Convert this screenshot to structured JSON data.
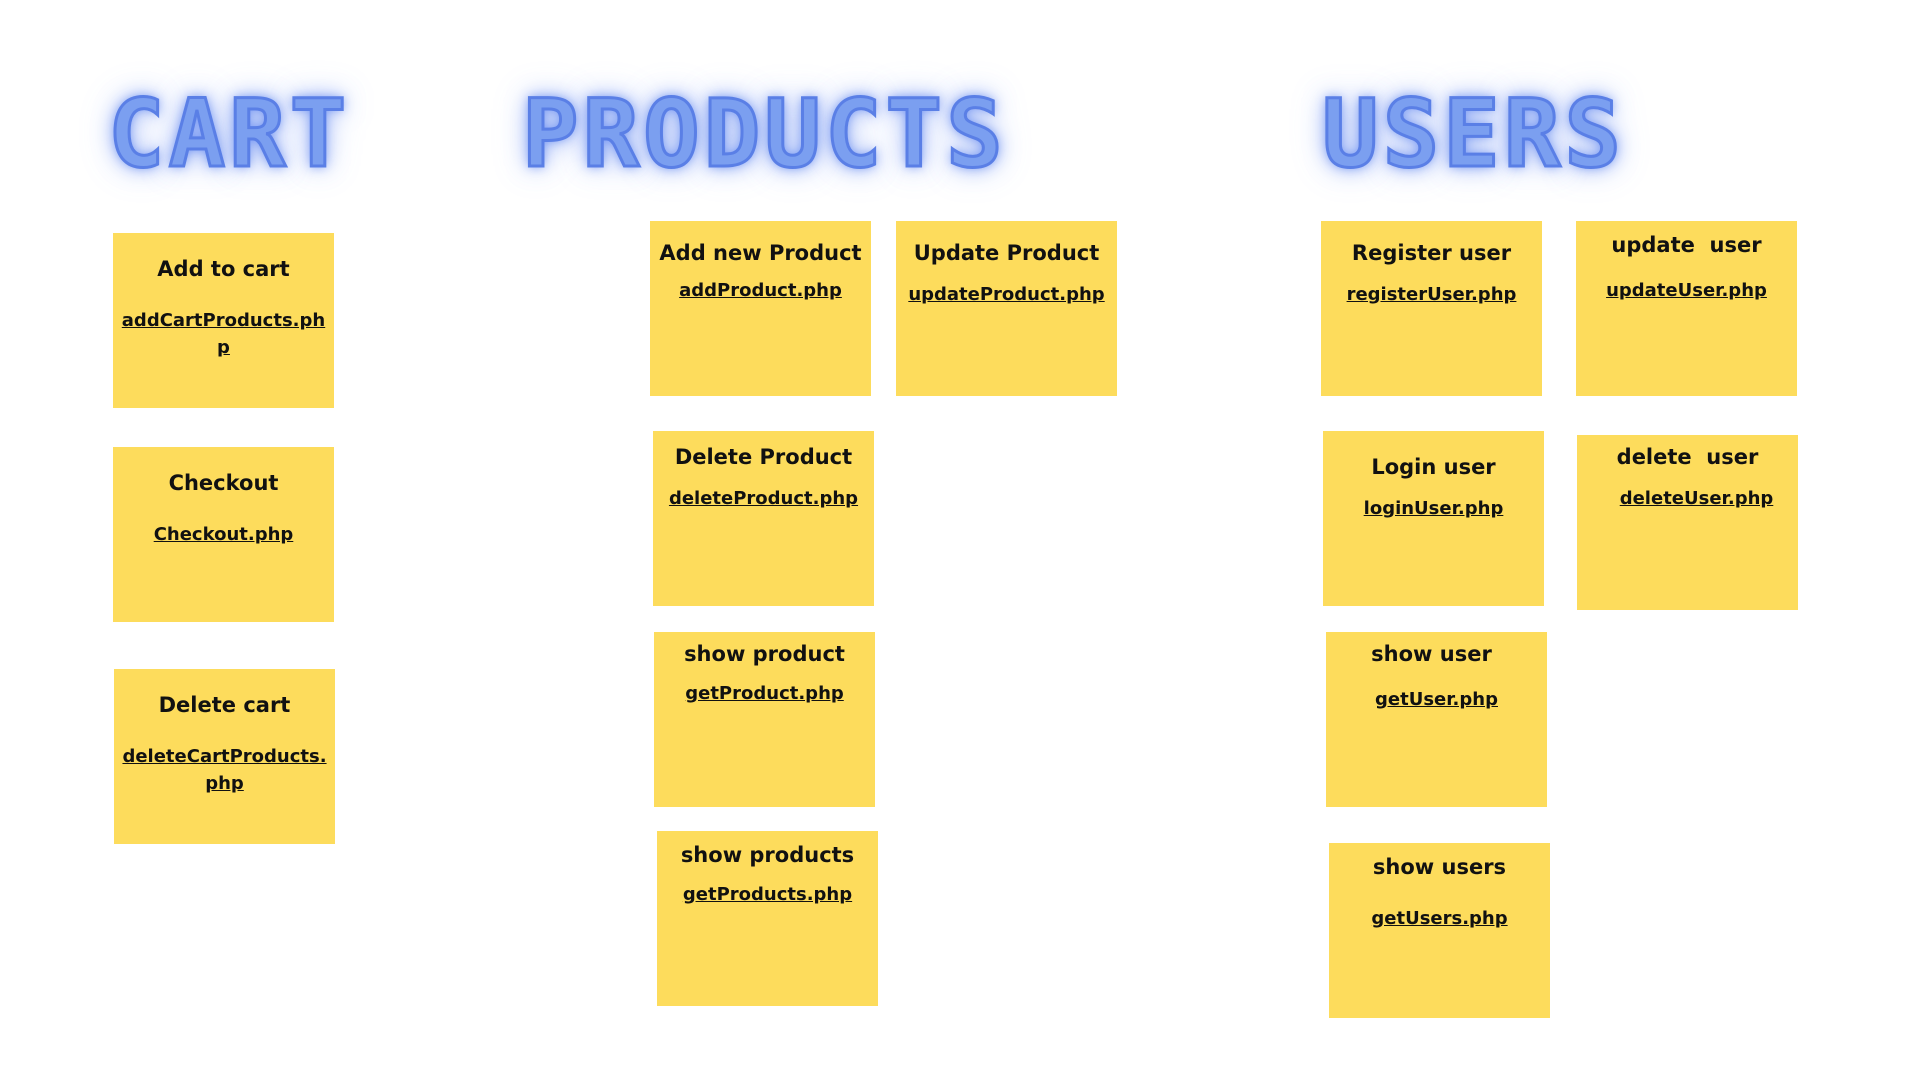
{
  "sections": {
    "cart": {
      "heading": "CART",
      "notes": [
        {
          "title": "Add to cart",
          "file": "addCartProducts.php"
        },
        {
          "title": "Checkout",
          "file": "Checkout.php"
        },
        {
          "title": "Delete cart",
          "file": "deleteCartProducts.php"
        }
      ]
    },
    "products": {
      "heading": "PRODUCTS",
      "notes": [
        {
          "title": "Add new Product",
          "file": "addProduct.php"
        },
        {
          "title": "Update Product",
          "file": "updateProduct.php"
        },
        {
          "title": "Delete Product",
          "file": "deleteProduct.php"
        },
        {
          "title": "show product",
          "file": "getProduct.php"
        },
        {
          "title": "show products",
          "file": "getProducts.php"
        }
      ]
    },
    "users": {
      "heading": "USERS",
      "notes": [
        {
          "title": "Register user",
          "file": "registerUser.php"
        },
        {
          "title": "update  user",
          "file": "updateUser.php"
        },
        {
          "title": "Login user",
          "file": "loginUser.php"
        },
        {
          "title": "delete  user",
          "file": "deleteUser.php"
        },
        {
          "title": "show user",
          "file": "getUser.php"
        },
        {
          "title": "show users",
          "file": "getUsers.php"
        }
      ]
    }
  },
  "colors": {
    "note": "#fddc5c",
    "heading": "#7b9ff0",
    "text": "#111111"
  }
}
